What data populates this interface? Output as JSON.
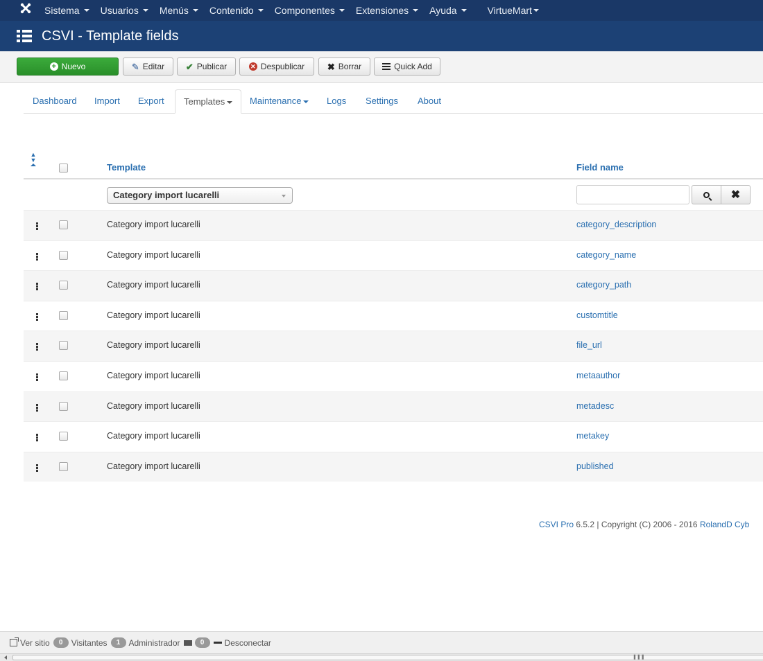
{
  "topbar": {
    "menu": [
      {
        "label": "Sistema",
        "dropdown": true
      },
      {
        "label": "Usuarios",
        "dropdown": true
      },
      {
        "label": "Menús",
        "dropdown": true
      },
      {
        "label": "Contenido",
        "dropdown": true
      },
      {
        "label": "Componentes",
        "dropdown": true
      },
      {
        "label": "Extensiones",
        "dropdown": true
      },
      {
        "label": "Ayuda",
        "dropdown": true
      },
      {
        "label": "VirtueMart",
        "dropdown": true
      }
    ],
    "logo_icon": "joomla-logo-icon"
  },
  "header": {
    "title": "CSVI - Template fields",
    "icon": "list-icon"
  },
  "toolbar": {
    "new_label": "Nuevo",
    "edit_label": "Editar",
    "publish_label": "Publicar",
    "unpublish_label": "Despublicar",
    "delete_label": "Borrar",
    "quickadd_label": "Quick Add"
  },
  "tabs": {
    "dashboard": "Dashboard",
    "import": "Import",
    "export": "Export",
    "templates": "Templates",
    "maintenance": "Maintenance",
    "logs": "Logs",
    "settings": "Settings",
    "about": "About",
    "active": "Templates"
  },
  "table": {
    "col_template": "Template",
    "col_field": "Field name",
    "filter_template": "Category import lucarelli",
    "search_placeholder": "",
    "rows": [
      {
        "template": "Category import lucarelli",
        "field": "category_description"
      },
      {
        "template": "Category import lucarelli",
        "field": "category_name"
      },
      {
        "template": "Category import lucarelli",
        "field": "category_path"
      },
      {
        "template": "Category import lucarelli",
        "field": "customtitle"
      },
      {
        "template": "Category import lucarelli",
        "field": "file_url"
      },
      {
        "template": "Category import lucarelli",
        "field": "metaauthor"
      },
      {
        "template": "Category import lucarelli",
        "field": "metadesc"
      },
      {
        "template": "Category import lucarelli",
        "field": "metakey"
      },
      {
        "template": "Category import lucarelli",
        "field": "published"
      }
    ]
  },
  "footer": {
    "product": "CSVI Pro",
    "version": "6.5.2",
    "copyright_text": "| Copyright (C) 2006 - 2016",
    "company": "RolandD Cyb"
  },
  "statusbar": {
    "view_site": "Ver sitio",
    "visitors_count": "0",
    "visitors_label": "Visitantes",
    "admins_count": "1",
    "admins_label": "Administrador",
    "messages_count": "0",
    "logout_label": "Desconectar"
  },
  "colors": {
    "topbar_bg": "#1a3867",
    "header_bg": "#1c4175",
    "new_button": "#2f9a2f",
    "link": "#2a6fb0"
  }
}
